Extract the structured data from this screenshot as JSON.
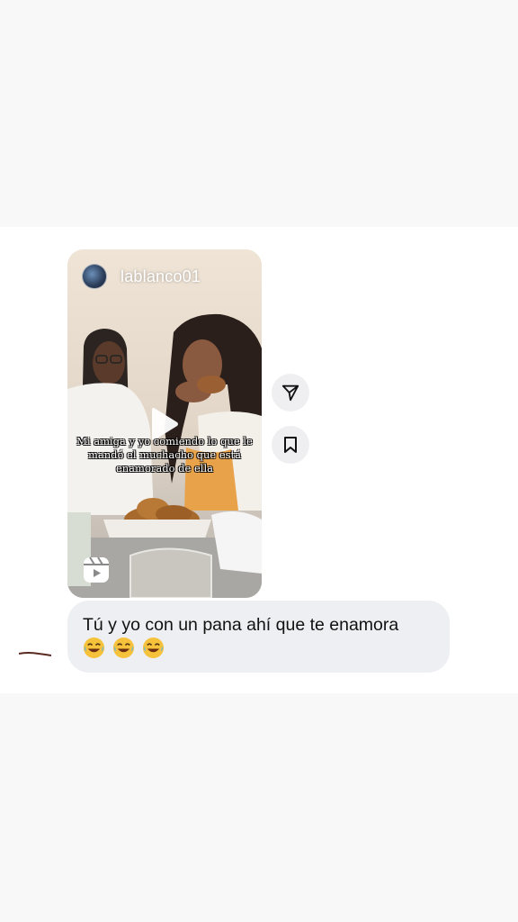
{
  "reel": {
    "username": "lablanco01",
    "caption": "Mi amiga y yo comiendo lo que le mandó el muchacho que está enamorado de ella"
  },
  "message": {
    "text": "Tú y yo con un pana ahí que te enamora",
    "emojis": [
      "😂",
      "😂",
      "😂"
    ]
  },
  "icons": {
    "share": "send-icon",
    "save": "bookmark-icon",
    "play": "play-icon",
    "reels": "reels-icon"
  },
  "colors": {
    "bubble": "#eeeff2",
    "side_button": "#efeff1",
    "background": "#ffffff"
  }
}
